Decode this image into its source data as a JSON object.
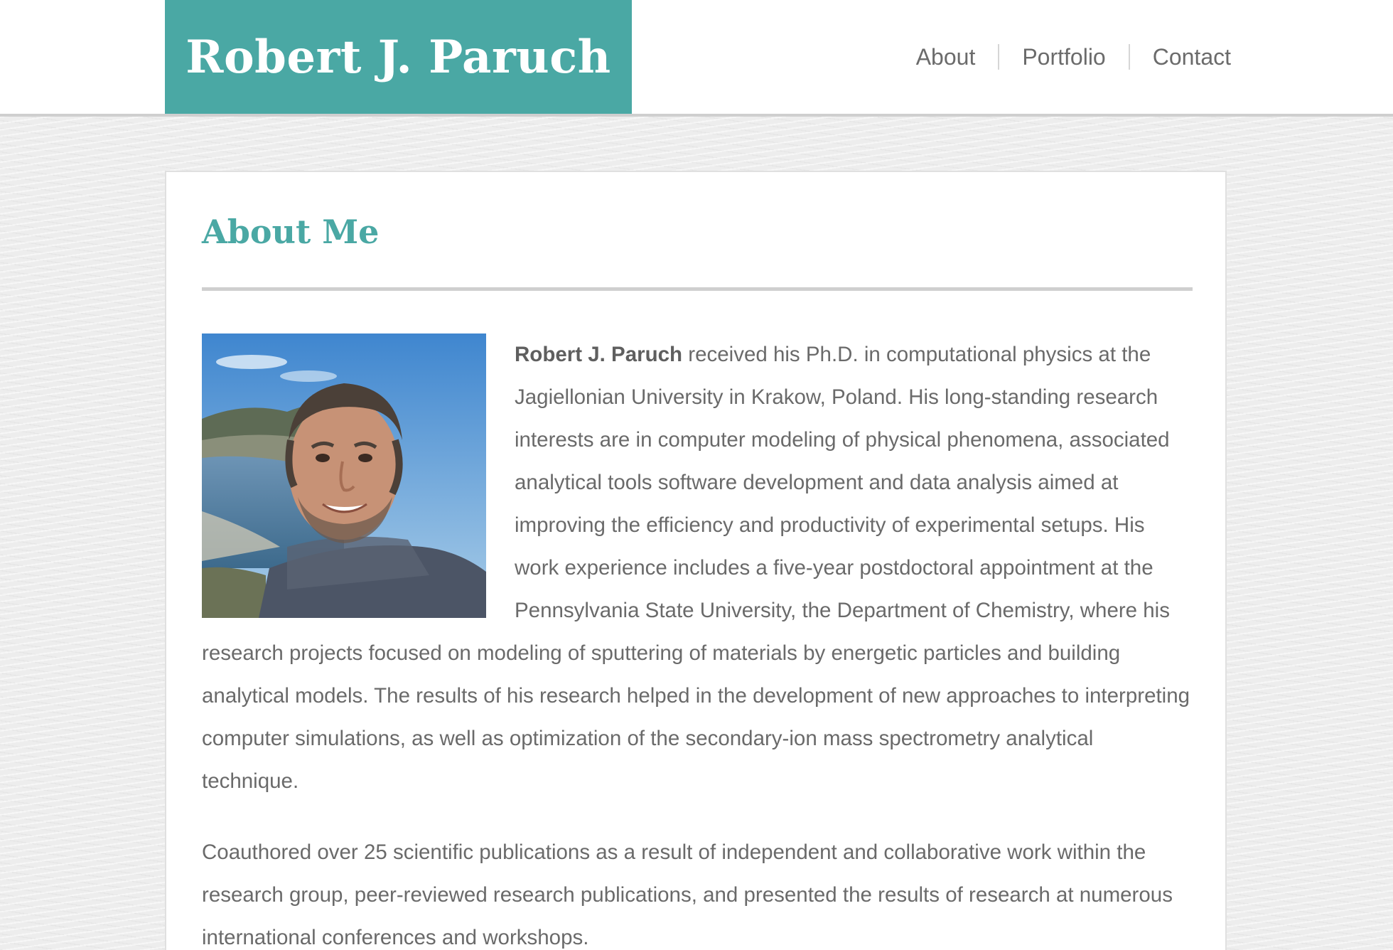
{
  "header": {
    "brand": "Robert J. Paruch",
    "nav": [
      {
        "label": "About"
      },
      {
        "label": "Portfolio"
      },
      {
        "label": "Contact"
      }
    ]
  },
  "about": {
    "title": "About Me",
    "photo_alt": "Portrait of Robert J. Paruch",
    "paragraphs": [
      {
        "strong": "Robert J. Paruch",
        "text": " received his Ph.D. in computational physics at the Jagiellonian University in Krakow, Poland. His long-standing research interests are in computer modeling of physical phenomena, associated analytical tools software development and data analysis aimed at improving the efficiency and productivity of experimental setups. His work experience includes a five-year postdoctoral appointment at the Pennsylvania State University, the Department of Chemistry, where his research projects focused on modeling of sputtering of materials by energetic particles and building analytical models. The results of his research helped in the development of new approaches to interpreting computer simulations, as well as optimization of the secondary-ion mass spectrometry analytical technique."
      },
      {
        "text": "Coauthored over 25 scientific publications as a result of independent and collaborative work within the research group, peer-reviewed research publications, and presented the results of research at numerous international conferences and workshops."
      }
    ]
  },
  "colors": {
    "accent": "#4aa8a4",
    "text": "#6a6a6a",
    "nav_text": "#6b6b6b"
  }
}
